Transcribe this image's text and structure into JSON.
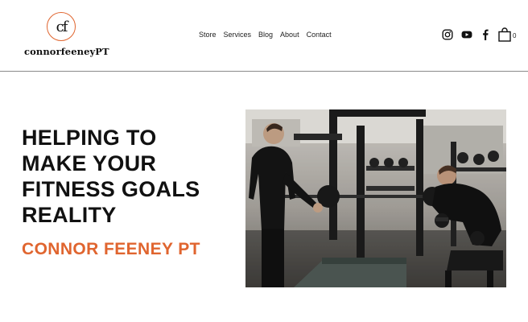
{
  "brand": {
    "logo_mark": "cf",
    "logo_text": "connorfeeneyPT",
    "accent_color": "#e0652f"
  },
  "nav": {
    "items": [
      {
        "label": "Store"
      },
      {
        "label": "Services"
      },
      {
        "label": "Blog"
      },
      {
        "label": "About"
      },
      {
        "label": "Contact"
      }
    ]
  },
  "social": {
    "icons": [
      "instagram-icon",
      "youtube-icon",
      "facebook-icon"
    ]
  },
  "cart": {
    "icon": "shopping-bag-icon",
    "count": "0"
  },
  "hero": {
    "headline": "HELPING TO MAKE YOUR FITNESS GOALS REALITY",
    "subheadline": "CONNOR FEENEY PT"
  }
}
